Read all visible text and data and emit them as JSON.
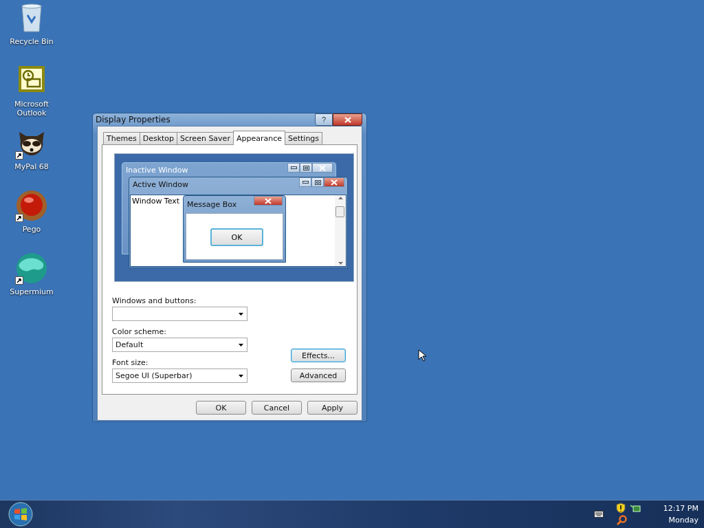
{
  "desktop_icons": [
    {
      "label": "Recycle Bin",
      "kind": "recycle-bin",
      "shortcut": false
    },
    {
      "label": "Microsoft Outlook",
      "kind": "outlook",
      "shortcut": false
    },
    {
      "label": "MyPal 68",
      "kind": "raccoon",
      "shortcut": true
    },
    {
      "label": "Pego",
      "kind": "orb",
      "shortcut": true
    },
    {
      "label": "Supermium",
      "kind": "sphere",
      "shortcut": true
    }
  ],
  "dialog": {
    "title": "Display Properties",
    "help_label": "?",
    "tabs": [
      {
        "label": "Themes",
        "selected": false
      },
      {
        "label": "Desktop",
        "selected": false
      },
      {
        "label": "Screen Saver",
        "selected": false
      },
      {
        "label": "Appearance",
        "selected": true
      },
      {
        "label": "Settings",
        "selected": false
      }
    ],
    "preview": {
      "inactive_title": "Inactive Window",
      "active_title": "Active Window",
      "window_text": "Window Text",
      "message_title": "Message Box",
      "message_button": "OK"
    },
    "fields": [
      {
        "label": "Windows and buttons:"
      },
      {
        "label": "Color scheme:",
        "value": "Default"
      },
      {
        "label": "Font size:",
        "value": "Segoe UI (Superbar)"
      }
    ],
    "side_buttons": [
      {
        "label": "Effects...",
        "focused": true
      },
      {
        "label": "Advanced",
        "focused": false
      }
    ],
    "buttons": [
      "OK",
      "Cancel",
      "Apply"
    ]
  },
  "taskbar": {
    "time": "12:17 PM",
    "day": "Monday"
  }
}
